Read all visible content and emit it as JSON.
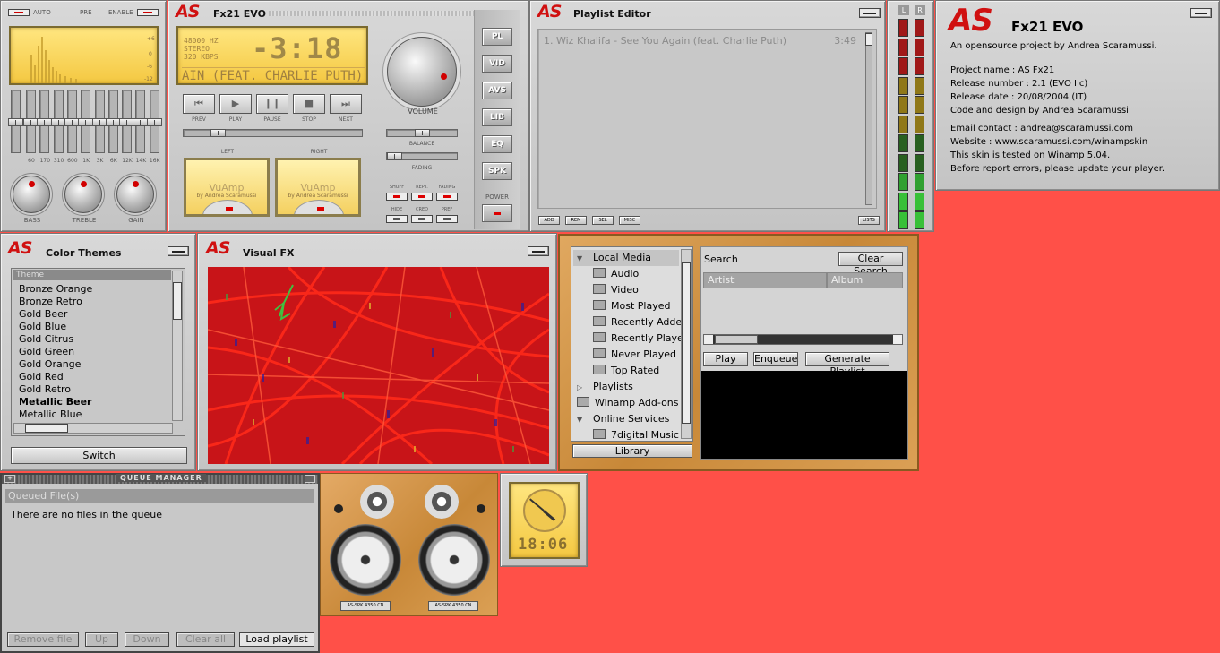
{
  "eq": {
    "auto": "AUTO",
    "pre": "PRE",
    "enable": "ENABLE",
    "freqs": [
      "60",
      "170",
      "310",
      "600",
      "1K",
      "3K",
      "6K",
      "12K",
      "14K",
      "16K"
    ],
    "knobs": [
      "BASS",
      "TREBLE",
      "GAIN"
    ],
    "scale": [
      "+6",
      "0",
      "-6",
      "-12"
    ]
  },
  "player": {
    "title": "Fx21 EVO",
    "hz": "48000 HZ",
    "mode": "STEREO",
    "kbps": "320 KBPS",
    "time": "-3:18",
    "marquee": "AIN (FEAT. CHARLIE PUTH)",
    "controls": [
      "PREV",
      "PLAY",
      "PAUSE",
      "STOP",
      "NEXT"
    ],
    "volume_label": "VOLUME",
    "balance_label": "BALANCE",
    "fading_label": "FADING",
    "left_label": "LEFT",
    "right_label": "RIGHT",
    "vu_brand": "VuAmp",
    "vu_by": "by Andrea Scaramussi",
    "toggles": [
      "SHUFF",
      "REPT.",
      "FADING",
      "HIDE",
      "CRED",
      "PREF"
    ],
    "side_buttons": [
      "PL",
      "VID",
      "AVS",
      "LIB",
      "EQ",
      "SPK"
    ],
    "power": "POWER"
  },
  "playlist": {
    "title": "Playlist Editor",
    "track": "1. Wiz Khalifa - See You Again (feat. Charlie Puth)",
    "duration": "3:49",
    "buttons": [
      "ADD",
      "REM",
      "SEL",
      "MISC"
    ],
    "lists": "LISTS"
  },
  "meter": {
    "left": "L",
    "right": "R"
  },
  "about": {
    "title": "Fx21 EVO",
    "tagline": "An opensource project by Andrea Scaramussi.",
    "lines1": [
      "Project name : AS Fx21",
      "Release number : 2.1 (EVO IIc)",
      "Release date : 20/08/2004 (IT)",
      "Code and design by Andrea Scaramussi"
    ],
    "lines2": [
      "Email contact : andrea@scaramussi.com",
      "Website : www.scaramussi.com/winampskin",
      "This skin is tested on Winamp 5.04.",
      "Before report errors, please update your player."
    ]
  },
  "themes": {
    "title": "Color Themes",
    "header": "Theme",
    "items": [
      "Bronze Orange",
      "Bronze Retro",
      "Gold Beer",
      "Gold Blue",
      "Gold Citrus",
      "Gold Green",
      "Gold Orange",
      "Gold Red",
      "Gold Retro",
      "Metallic Beer",
      "Metallic Blue"
    ],
    "selected": "Metallic Beer",
    "switch": "Switch"
  },
  "visual": {
    "title": "Visual FX"
  },
  "library": {
    "tree": [
      "Local Media",
      "Audio",
      "Video",
      "Most Played",
      "Recently Added",
      "Recently Played",
      "Never Played",
      "Top Rated",
      "Playlists",
      "Winamp Add-ons",
      "Online Services",
      "7digital Music"
    ],
    "library_btn": "Library",
    "search_label": "Search:",
    "clear_search": "Clear Search",
    "columns": [
      "Artist",
      "Album"
    ],
    "buttons": [
      "Play",
      "Enqueue",
      "Generate Playlist"
    ]
  },
  "queue": {
    "title": "QUEUE MANAGER",
    "header": "Queued File(s)",
    "empty": "There are no files in the queue",
    "buttons": [
      "Remove file",
      "Up",
      "Down",
      "Clear all",
      "Load playlist"
    ]
  },
  "speakers": {
    "label": "AS-SPK 4350 CN"
  },
  "clock": {
    "display": "18:06"
  }
}
